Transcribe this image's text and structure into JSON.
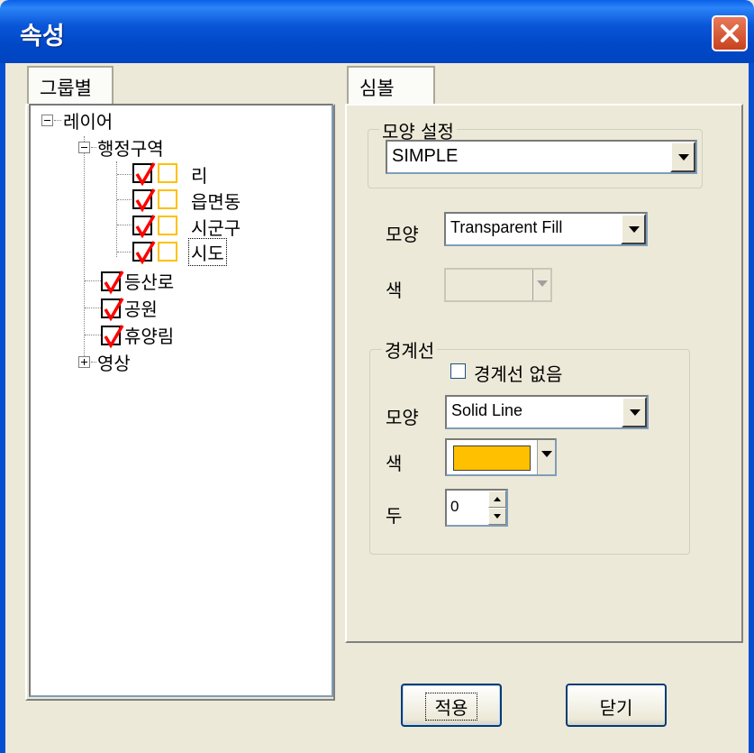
{
  "window": {
    "title": "속성"
  },
  "left_tab": {
    "label": "그룹별"
  },
  "tree": {
    "root": {
      "label": "레이어",
      "expanded": true
    },
    "admin_group": {
      "label": "행정구역",
      "expanded": true
    },
    "admin_items": [
      {
        "label": "리",
        "checked": true
      },
      {
        "label": "읍면동",
        "checked": true
      },
      {
        "label": "시군구",
        "checked": true
      },
      {
        "label": "시도",
        "checked": true,
        "selected": true
      }
    ],
    "layers": [
      {
        "label": "등산로",
        "checked": true
      },
      {
        "label": "공원",
        "checked": true
      },
      {
        "label": "휴양림",
        "checked": true
      }
    ],
    "image_group": {
      "label": "영상",
      "expanded": false
    }
  },
  "right_tab": {
    "label": "심볼"
  },
  "shape_setting": {
    "legend": "모양 설정",
    "value": "SIMPLE"
  },
  "fill": {
    "shape_label": "모양",
    "shape_value": "Transparent Fill",
    "color_label": "색"
  },
  "border": {
    "legend": "경계선",
    "no_border_label": "경계선 없음",
    "no_border_checked": false,
    "shape_label": "모양",
    "shape_value": "Solid Line",
    "color_label": "색",
    "color": "#ffc000",
    "width_label": "두",
    "width_value": "0"
  },
  "buttons": {
    "apply": "적용",
    "close": "닫기"
  },
  "colors": {
    "titlebar": "#0054e3",
    "check_mark": "#ff0000",
    "swatch_border": "#ffc000"
  }
}
